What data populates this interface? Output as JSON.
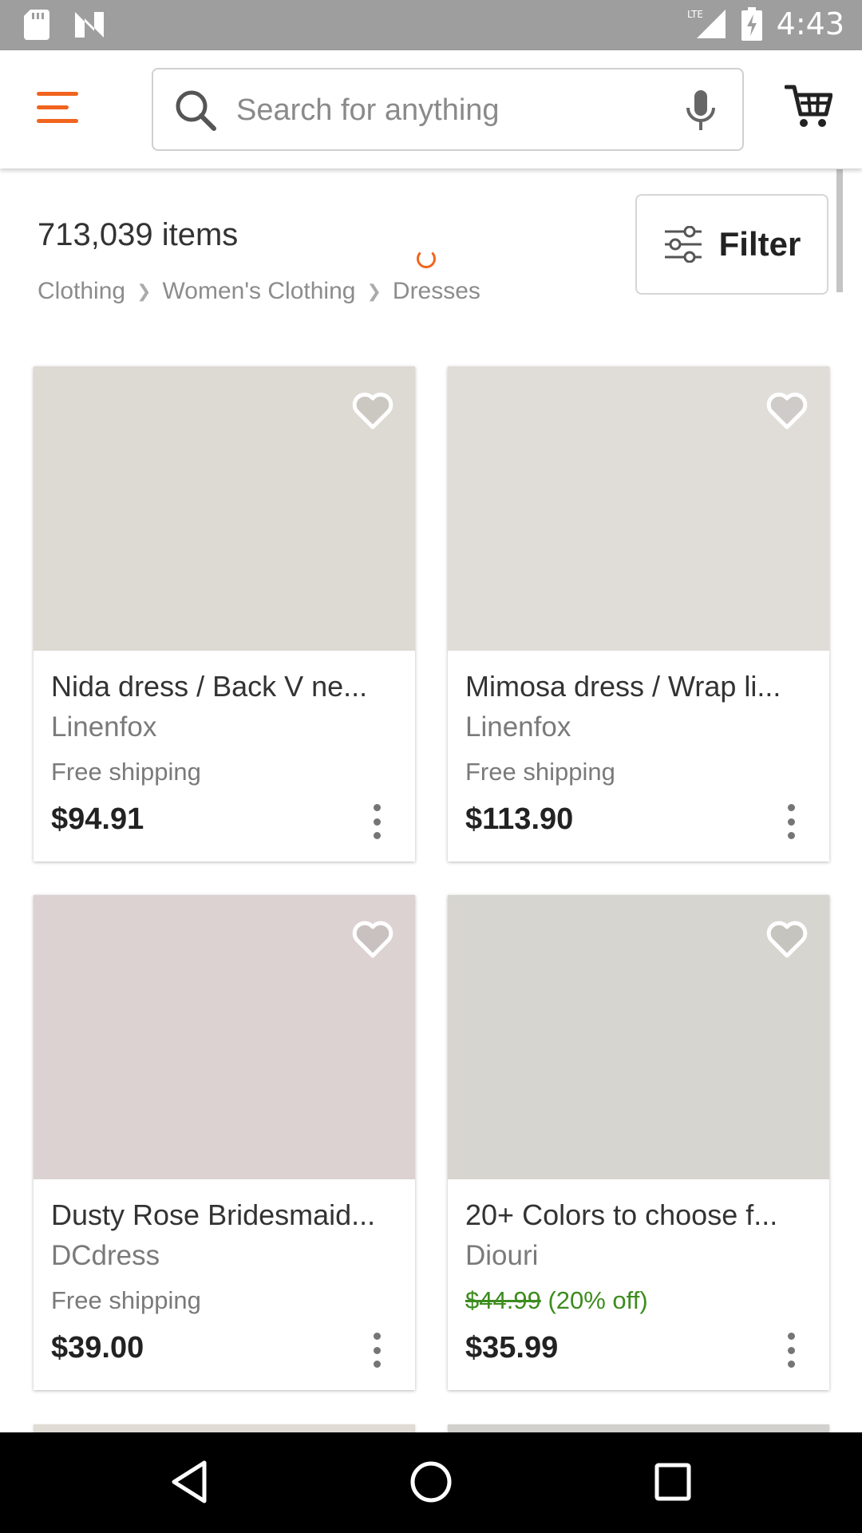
{
  "status_bar": {
    "time": "4:43",
    "network": "LTE",
    "background": "#9e9e9e"
  },
  "search": {
    "placeholder": "Search for anything"
  },
  "colors": {
    "accent": "#f1641e",
    "discount_green": "#3d8c1e"
  },
  "results": {
    "count": "713,039 items",
    "breadcrumb": [
      "Clothing",
      "Women's Clothing",
      "Dresses"
    ],
    "filter_label": "Filter"
  },
  "listings": [
    {
      "title": "Nida dress / Back V ne...",
      "shop": "Linenfox",
      "shipping": "Free shipping",
      "price": "$94.91",
      "image_color": "#ddd9d3"
    },
    {
      "title": "Mimosa dress / Wrap li...",
      "shop": "Linenfox",
      "shipping": "Free shipping",
      "price": "$113.90",
      "image_color": "#e0ddd9"
    },
    {
      "title": "Dusty Rose Bridesmaid...",
      "shop": "DCdress",
      "shipping": "Free shipping",
      "price": "$39.00",
      "image_color": "#dbd2d1"
    },
    {
      "title": "20+ Colors to choose f...",
      "shop": "Diouri",
      "original_price": "$44.99",
      "discount": "(20% off)",
      "price": "$35.99",
      "image_color": "#d7d5cf"
    }
  ]
}
